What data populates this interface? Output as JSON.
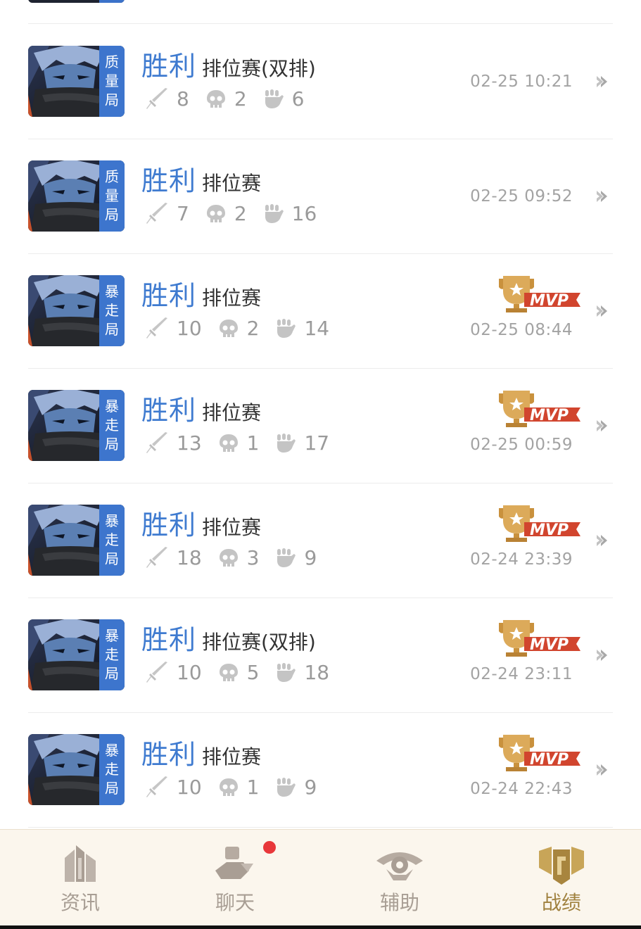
{
  "matches": [
    {
      "result": "胜利",
      "mode": "排位赛(双排)",
      "tag": [
        "质",
        "量",
        "局"
      ],
      "kills": "8",
      "deaths": "2",
      "assists": "6",
      "time": "02-25 10:21",
      "mvp": false
    },
    {
      "result": "胜利",
      "mode": "排位赛",
      "tag": [
        "质",
        "量",
        "局"
      ],
      "kills": "7",
      "deaths": "2",
      "assists": "16",
      "time": "02-25 09:52",
      "mvp": false
    },
    {
      "result": "胜利",
      "mode": "排位赛",
      "tag": [
        "暴",
        "走",
        "局"
      ],
      "kills": "10",
      "deaths": "2",
      "assists": "14",
      "time": "02-25 08:44",
      "mvp": true
    },
    {
      "result": "胜利",
      "mode": "排位赛",
      "tag": [
        "暴",
        "走",
        "局"
      ],
      "kills": "13",
      "deaths": "1",
      "assists": "17",
      "time": "02-25 00:59",
      "mvp": true
    },
    {
      "result": "胜利",
      "mode": "排位赛",
      "tag": [
        "暴",
        "走",
        "局"
      ],
      "kills": "18",
      "deaths": "3",
      "assists": "9",
      "time": "02-24 23:39",
      "mvp": true
    },
    {
      "result": "胜利",
      "mode": "排位赛(双排)",
      "tag": [
        "暴",
        "走",
        "局"
      ],
      "kills": "10",
      "deaths": "5",
      "assists": "18",
      "time": "02-24 23:11",
      "mvp": true
    },
    {
      "result": "胜利",
      "mode": "排位赛",
      "tag": [
        "暴",
        "走",
        "局"
      ],
      "kills": "10",
      "deaths": "1",
      "assists": "9",
      "time": "02-24 22:43",
      "mvp": true
    }
  ],
  "mvp_label": "MVP",
  "tabs": [
    {
      "label": "资讯",
      "icon": "news-building-icon",
      "active": false,
      "badge": false
    },
    {
      "label": "聊天",
      "icon": "chat-people-icon",
      "active": false,
      "badge": true
    },
    {
      "label": "辅助",
      "icon": "assist-eye-icon",
      "active": false,
      "badge": false
    },
    {
      "label": "战绩",
      "icon": "record-crest-icon",
      "active": true,
      "badge": false
    }
  ],
  "colors": {
    "win": "#3f7bd0",
    "tag_bg": "#3d75cd",
    "muted": "#9a9a9a",
    "mvp_gold": "#d6a657",
    "mvp_red": "#d1452e",
    "tab_active": "#a0813f",
    "tab_inactive": "#a89e94",
    "badge_red": "#e8373a"
  }
}
